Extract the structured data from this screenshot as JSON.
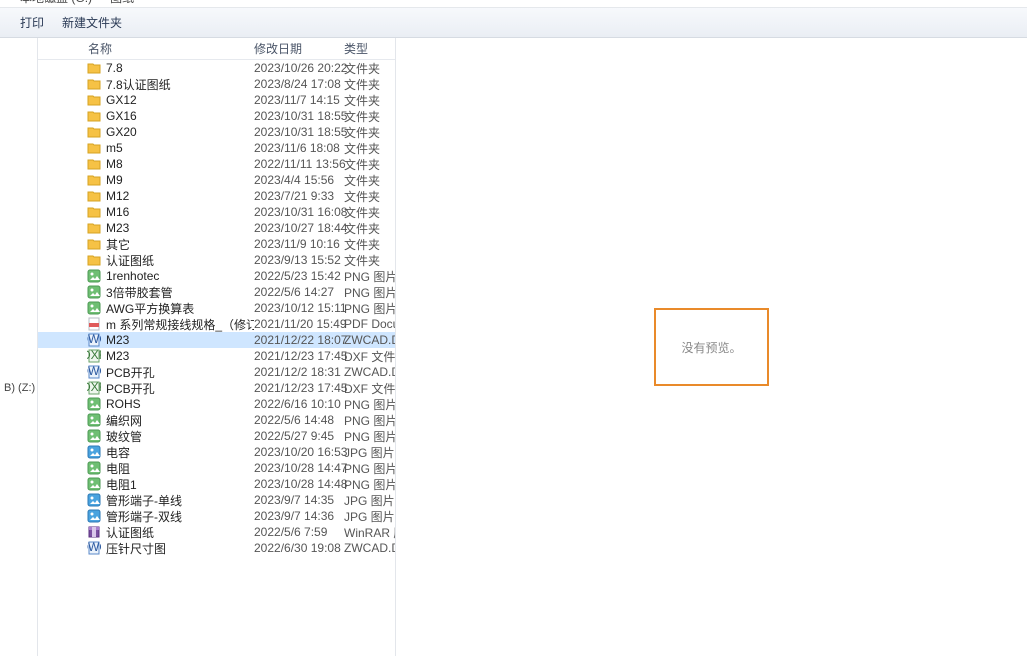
{
  "breadcrumb": {
    "seg1": "本地磁盘 (G:)",
    "seg2": "图纸"
  },
  "toolbar": {
    "print": "打印",
    "newfolder": "新建文件夹"
  },
  "leftnav": {
    "drive": "B) (Z:)"
  },
  "columns": {
    "name": "名称",
    "date": "修改日期",
    "type": "类型"
  },
  "preview": {
    "text": "没有预览。"
  },
  "files": [
    {
      "icon": "folder",
      "name": "7.8",
      "date": "2023/10/26 20:22",
      "type": "文件夹"
    },
    {
      "icon": "folder",
      "name": "7.8认证图纸",
      "date": "2023/8/24 17:08",
      "type": "文件夹"
    },
    {
      "icon": "folder",
      "name": "GX12",
      "date": "2023/11/7 14:15",
      "type": "文件夹"
    },
    {
      "icon": "folder",
      "name": "GX16",
      "date": "2023/10/31 18:55",
      "type": "文件夹"
    },
    {
      "icon": "folder",
      "name": "GX20",
      "date": "2023/10/31 18:55",
      "type": "文件夹"
    },
    {
      "icon": "folder",
      "name": "m5",
      "date": "2023/11/6 18:08",
      "type": "文件夹"
    },
    {
      "icon": "folder",
      "name": "M8",
      "date": "2022/11/11 13:56",
      "type": "文件夹"
    },
    {
      "icon": "folder",
      "name": "M9",
      "date": "2023/4/4 15:56",
      "type": "文件夹"
    },
    {
      "icon": "folder",
      "name": "M12",
      "date": "2023/7/21 9:33",
      "type": "文件夹"
    },
    {
      "icon": "folder",
      "name": "M16",
      "date": "2023/10/31 16:08",
      "type": "文件夹"
    },
    {
      "icon": "folder",
      "name": "M23",
      "date": "2023/10/27 18:44",
      "type": "文件夹"
    },
    {
      "icon": "folder",
      "name": "其它",
      "date": "2023/11/9 10:16",
      "type": "文件夹"
    },
    {
      "icon": "folder",
      "name": "认证图纸",
      "date": "2023/9/13 15:52",
      "type": "文件夹"
    },
    {
      "icon": "png",
      "name": "1renhotec",
      "date": "2022/5/23 15:42",
      "type": "PNG 图片文件"
    },
    {
      "icon": "png",
      "name": "3倍带胶套管",
      "date": "2022/5/6 14:27",
      "type": "PNG 图片文件"
    },
    {
      "icon": "png",
      "name": "AWG平方换算表",
      "date": "2023/10/12 15:11",
      "type": "PNG 图片文件"
    },
    {
      "icon": "pdf",
      "name": "m 系列常规接线规格_（修订版）",
      "date": "2021/11/20 15:49",
      "type": "PDF Document"
    },
    {
      "icon": "dwg",
      "name": "M23",
      "date": "2021/12/22 18:07",
      "type": "ZWCAD.Drawing",
      "selected": true
    },
    {
      "icon": "dxf",
      "name": "M23",
      "date": "2021/12/23 17:45",
      "type": "DXF 文件"
    },
    {
      "icon": "dwg",
      "name": "PCB开孔",
      "date": "2021/12/2 18:31",
      "type": "ZWCAD.Drawing"
    },
    {
      "icon": "dxf",
      "name": "PCB开孔",
      "date": "2021/12/23 17:45",
      "type": "DXF 文件"
    },
    {
      "icon": "png",
      "name": "ROHS",
      "date": "2022/6/16 10:10",
      "type": "PNG 图片文件"
    },
    {
      "icon": "png",
      "name": "编织网",
      "date": "2022/5/6 14:48",
      "type": "PNG 图片文件"
    },
    {
      "icon": "png",
      "name": "玻纹管",
      "date": "2022/5/27 9:45",
      "type": "PNG 图片文件"
    },
    {
      "icon": "jpg",
      "name": "电容",
      "date": "2023/10/20 16:53",
      "type": "JPG 图片文件"
    },
    {
      "icon": "png",
      "name": "电阻",
      "date": "2023/10/28 14:47",
      "type": "PNG 图片文件"
    },
    {
      "icon": "png",
      "name": "电阻1",
      "date": "2023/10/28 14:48",
      "type": "PNG 图片文件"
    },
    {
      "icon": "jpg",
      "name": "管形端子-单线",
      "date": "2023/9/7 14:35",
      "type": "JPG 图片文件"
    },
    {
      "icon": "jpg",
      "name": "管形端子-双线",
      "date": "2023/9/7 14:36",
      "type": "JPG 图片文件"
    },
    {
      "icon": "rar",
      "name": "认证图纸",
      "date": "2022/5/6 7:59",
      "type": "WinRAR 压缩文..."
    },
    {
      "icon": "dwg",
      "name": "压针尺寸图",
      "date": "2022/6/30 19:08",
      "type": "ZWCAD.Drawing"
    }
  ]
}
